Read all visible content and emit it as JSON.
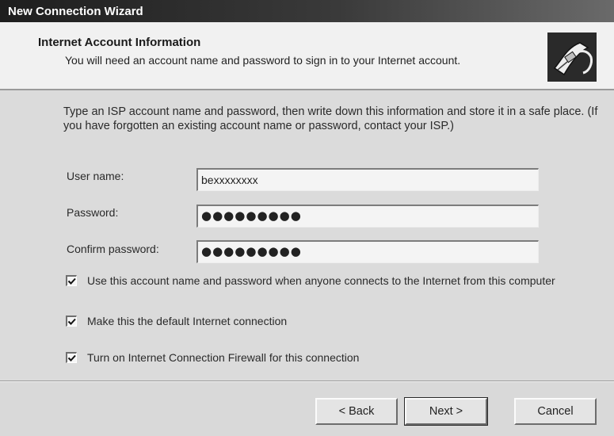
{
  "window": {
    "title": "New Connection Wizard"
  },
  "header": {
    "title": "Internet Account Information",
    "subtitle": "You will need an account name and password to sign in to your Internet account.",
    "icon": "network-cable-icon"
  },
  "intro": "Type an ISP account name and password, then write down this information and store it in a safe place. (If you have forgotten an existing account name or password, contact your ISP.)",
  "fields": {
    "username": {
      "label": "User name:",
      "value": "bexxxxxxxx"
    },
    "password": {
      "label": "Password:",
      "value": "●●●●●●●●●"
    },
    "confirm": {
      "label": "Confirm password:",
      "value": "●●●●●●●●●"
    }
  },
  "checkboxes": [
    {
      "label": "Use this account  name and password when anyone connects to the Internet from this computer",
      "checked": true
    },
    {
      "label": "Make this the default Internet connection",
      "checked": true
    },
    {
      "label": "Turn on Internet Connection Firewall for this connection",
      "checked": true
    }
  ],
  "buttons": {
    "back": "< Back",
    "next": "Next >",
    "cancel": "Cancel"
  }
}
